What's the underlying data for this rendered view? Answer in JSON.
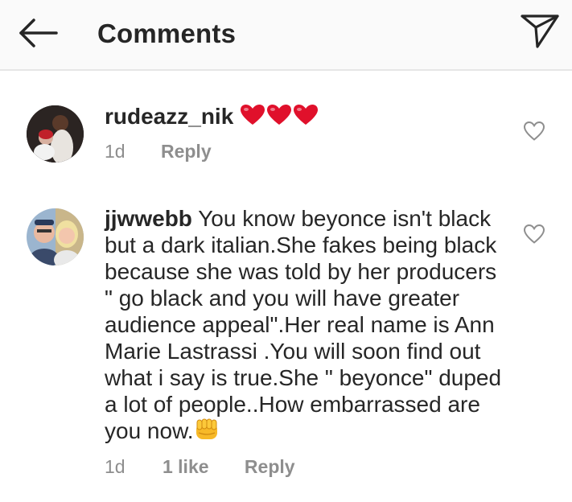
{
  "header": {
    "title": "Comments",
    "back_icon": "arrow-left-icon",
    "send_icon": "paper-plane-icon"
  },
  "comments": [
    {
      "username": "rudeazz_nik",
      "text": "",
      "emoji": "three-red-hearts",
      "time": "1d",
      "likes": "",
      "reply": "Reply"
    },
    {
      "username": "jjwwebb",
      "text": "You know beyonce isn't black but a dark italian.She fakes being black because she was told by her producers \" go black and you will have greater audience appeal\".Her real name is Ann Marie Lastrassi .You will soon find out what i say is true.She \" beyonce\" duped a lot of people..How embarrassed are you now.",
      "emoji": "oncoming-fist",
      "time": "1d",
      "likes": "1 like",
      "reply": "Reply"
    }
  ],
  "colors": {
    "header_bg": "#fafafa",
    "text": "#262626",
    "meta": "#8e8e8e",
    "heart_red": "#e0102b"
  }
}
